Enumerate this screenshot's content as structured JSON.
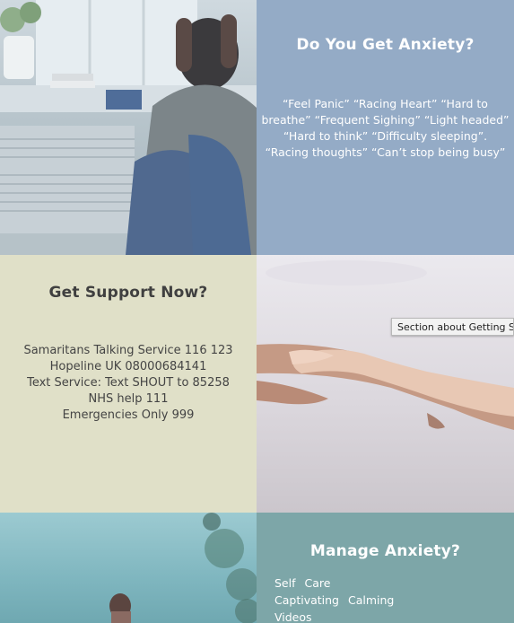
{
  "panel_anxiety": {
    "title": "Do You Get Anxiety?",
    "quote_text": "“Feel Panic” “Racing Heart” “Hard to breathe” “Frequent Sighing” “Light headed” “Hard to think” “Difficulty sleeping”. “Racing thoughts” “Can’t stop being busy”"
  },
  "panel_support": {
    "title": "Get Support Now?",
    "lines": [
      "Samaritans Talking Service 116 123",
      "Hopeline UK 08000684141",
      "Text Service: Text SHOUT to 85258",
      "NHS help 111",
      "Emergencies Only 999"
    ]
  },
  "tooltip": {
    "text": "Section about Getting Support"
  },
  "panel_manage": {
    "title": "Manage Anxiety?",
    "links": [
      "Self",
      "Care",
      "Captivating",
      "Calming",
      "Videos"
    ]
  },
  "colors": {
    "anxiety_panel": "#94abc6",
    "support_panel": "#e0e0c8",
    "manage_panel": "#7da6a8"
  }
}
